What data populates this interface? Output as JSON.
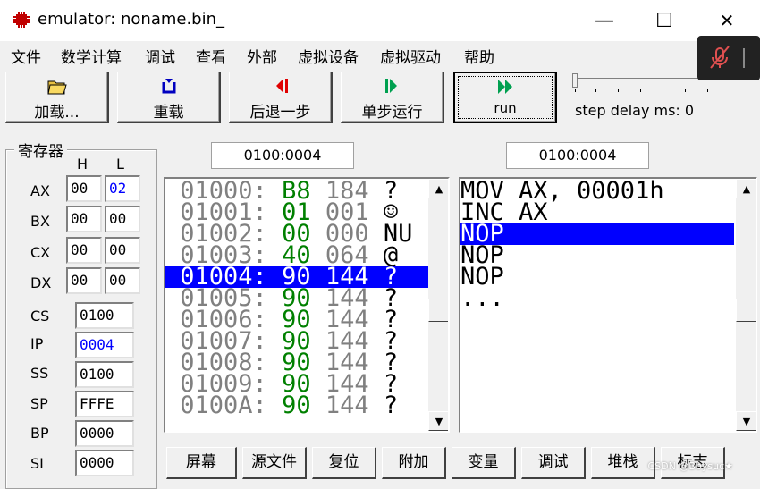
{
  "window": {
    "title": "emulator: noname.bin_",
    "minimize": "—",
    "maximize": "☐",
    "close": "✕"
  },
  "menu": [
    "文件",
    "数学计算",
    "调试",
    "查看",
    "外部",
    "虚拟设备",
    "虚拟驱动",
    "帮助"
  ],
  "toolbar": {
    "load": "加载...",
    "reload": "重载",
    "back": "后退一步",
    "step": "单步运行",
    "run": "run",
    "step_delay": "step delay ms: 0"
  },
  "registers": {
    "title": "寄存器",
    "h": "H",
    "l": "L",
    "rows": [
      {
        "name": "AX",
        "h": "00",
        "l": "02"
      },
      {
        "name": "BX",
        "h": "00",
        "l": "00"
      },
      {
        "name": "CX",
        "h": "00",
        "l": "00"
      },
      {
        "name": "DX",
        "h": "00",
        "l": "00"
      }
    ],
    "segs": [
      {
        "name": "CS",
        "value": "0100"
      },
      {
        "name": "IP",
        "value": "0004"
      },
      {
        "name": "SS",
        "value": "0100"
      },
      {
        "name": "SP",
        "value": "FFFE"
      },
      {
        "name": "BP",
        "value": "0000"
      },
      {
        "name": "SI",
        "value": "0000"
      }
    ]
  },
  "memory": {
    "address": "0100:0004",
    "rows": [
      {
        "addr": "01000:",
        "hex": "B8",
        "dec": "184",
        "chr": "?"
      },
      {
        "addr": "01001:",
        "hex": "01",
        "dec": "001",
        "chr": "☺"
      },
      {
        "addr": "01002:",
        "hex": "00",
        "dec": "000",
        "chr": "NU"
      },
      {
        "addr": "01003:",
        "hex": "40",
        "dec": "064",
        "chr": "@"
      },
      {
        "addr": "01004:",
        "hex": "90",
        "dec": "144",
        "chr": "?"
      },
      {
        "addr": "01005:",
        "hex": "90",
        "dec": "144",
        "chr": "?"
      },
      {
        "addr": "01006:",
        "hex": "90",
        "dec": "144",
        "chr": "?"
      },
      {
        "addr": "01007:",
        "hex": "90",
        "dec": "144",
        "chr": "?"
      },
      {
        "addr": "01008:",
        "hex": "90",
        "dec": "144",
        "chr": "?"
      },
      {
        "addr": "01009:",
        "hex": "90",
        "dec": "144",
        "chr": "?"
      },
      {
        "addr": "0100A:",
        "hex": "90",
        "dec": "144",
        "chr": "?"
      }
    ]
  },
  "disassembly": {
    "address": "0100:0004",
    "rows": [
      "MOV AX, 00001h",
      "INC AX",
      "NOP",
      "NOP",
      "NOP",
      "..."
    ]
  },
  "bottom_buttons": [
    "屏幕",
    "源文件",
    "复位",
    "附加",
    "变量",
    "调试",
    "堆栈",
    "标志"
  ],
  "watermark": "CSDN @Bbysuc★"
}
